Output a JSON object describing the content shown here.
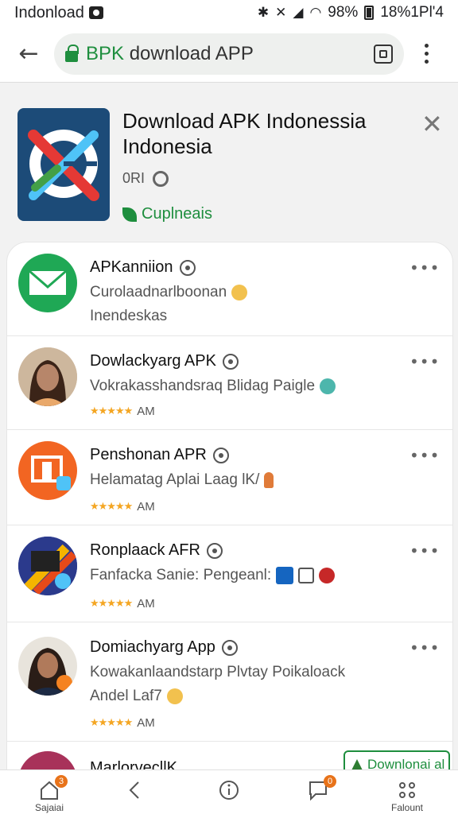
{
  "status_bar": {
    "carrier": "Indonload",
    "battery_level": "98%",
    "right_text": "18%1Pl'4"
  },
  "browser": {
    "url_brand": "BPK",
    "url_rest": "download APP"
  },
  "app_header": {
    "title": "Download APK Indonessia Indonesia",
    "meta": "0RI",
    "publisher": "Cuplneais",
    "brand_colors": {
      "logo_bg": "#1c4b78",
      "accent": "#1e8e3e"
    }
  },
  "list": {
    "items": [
      {
        "title": "APKanniion",
        "desc": "Curolaadnarlboonan",
        "desc2": "Inendeskas",
        "rating_text": "",
        "icon": "mail-icon"
      },
      {
        "title": "Dowlackyarg APK",
        "desc": "Vokrakasshandsraq Blidag Paigle",
        "desc2": "",
        "rating_text": "AM",
        "icon": "person-avatar"
      },
      {
        "title": "Penshonan APR",
        "desc": "Helamatag Aplai Laag lK/",
        "desc2": "",
        "rating_text": "AM",
        "icon": "orange-app-icon"
      },
      {
        "title": "Ronplaack AFR",
        "desc": "Fanfacka Sanie: Pengeanl:",
        "desc2": "",
        "rating_text": "AM",
        "icon": "stripe-app-icon"
      },
      {
        "title": "Domiachyarg App",
        "desc": "Kowakanlaandstarp Plvtay Poikaloack",
        "desc2": "Andel Laf7",
        "rating_text": "AM",
        "icon": "person-avatar"
      },
      {
        "title": "MarlorvecllK",
        "desc": "",
        "desc2": "",
        "rating_text": "",
        "icon": "red-app-icon"
      }
    ],
    "download_chip": "Downlonai al"
  },
  "bottom_nav": {
    "items": [
      {
        "label": "Sajaiai",
        "icon": "home-icon",
        "badge": "3"
      },
      {
        "label": "",
        "icon": "back-chevron-icon",
        "badge": ""
      },
      {
        "label": "",
        "icon": "info-icon",
        "badge": ""
      },
      {
        "label": "",
        "icon": "chat-icon",
        "badge": "0"
      },
      {
        "label": "Falount",
        "icon": "apps-grid-icon",
        "badge": ""
      }
    ]
  }
}
